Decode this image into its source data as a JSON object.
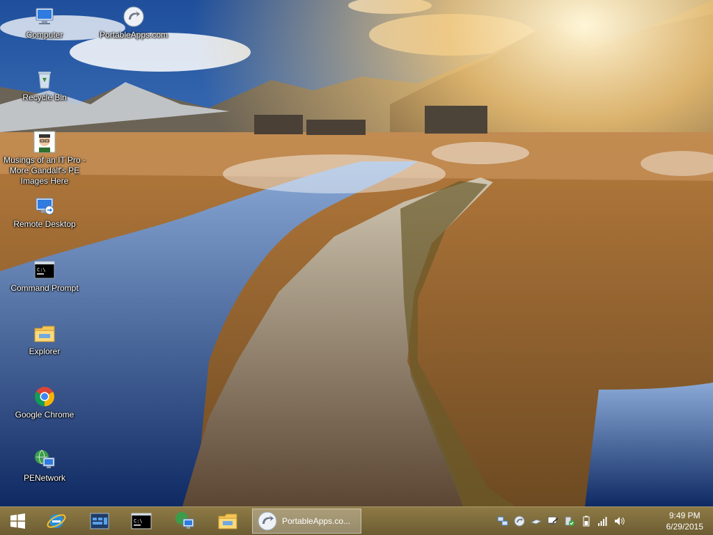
{
  "desktop": {
    "icons": [
      {
        "label": "Computer",
        "icon": "computer-icon"
      },
      {
        "label": "PortableApps.com",
        "icon": "portableapps-icon"
      },
      {
        "label": "Recycle Bin",
        "icon": "recycle-bin-icon"
      },
      {
        "label": "Musings of an IT Pro - More Gandalf's PE Images Here",
        "icon": "avatar-shortcut-icon"
      },
      {
        "label": "Remote Desktop",
        "icon": "remote-desktop-icon"
      },
      {
        "label": "Command Prompt",
        "icon": "command-prompt-icon"
      },
      {
        "label": "Explorer",
        "icon": "folder-icon"
      },
      {
        "label": "Google Chrome",
        "icon": "chrome-icon"
      },
      {
        "label": "PENetwork",
        "icon": "network-icon"
      }
    ]
  },
  "taskbar": {
    "pinned": [
      {
        "icon": "windows-start-icon"
      },
      {
        "icon": "internet-explorer-icon"
      },
      {
        "icon": "task-manager-icon"
      },
      {
        "icon": "command-prompt-icon"
      },
      {
        "icon": "network-icon"
      },
      {
        "icon": "file-explorer-icon"
      }
    ],
    "active_window_label": "PortableApps.co...",
    "tray_icons": [
      "network-connections-icon",
      "portableapps-tray-icon",
      "usb-drive-icon",
      "display-settings-icon",
      "security-check-icon",
      "battery-icon",
      "signal-icon",
      "volume-icon"
    ],
    "clock": {
      "time": "9:49 PM",
      "date": "6/29/2015"
    }
  },
  "colors": {
    "taskbar": "#7b6a3b",
    "sky": "#2b64b8",
    "sunlight": "#f7d58a"
  }
}
